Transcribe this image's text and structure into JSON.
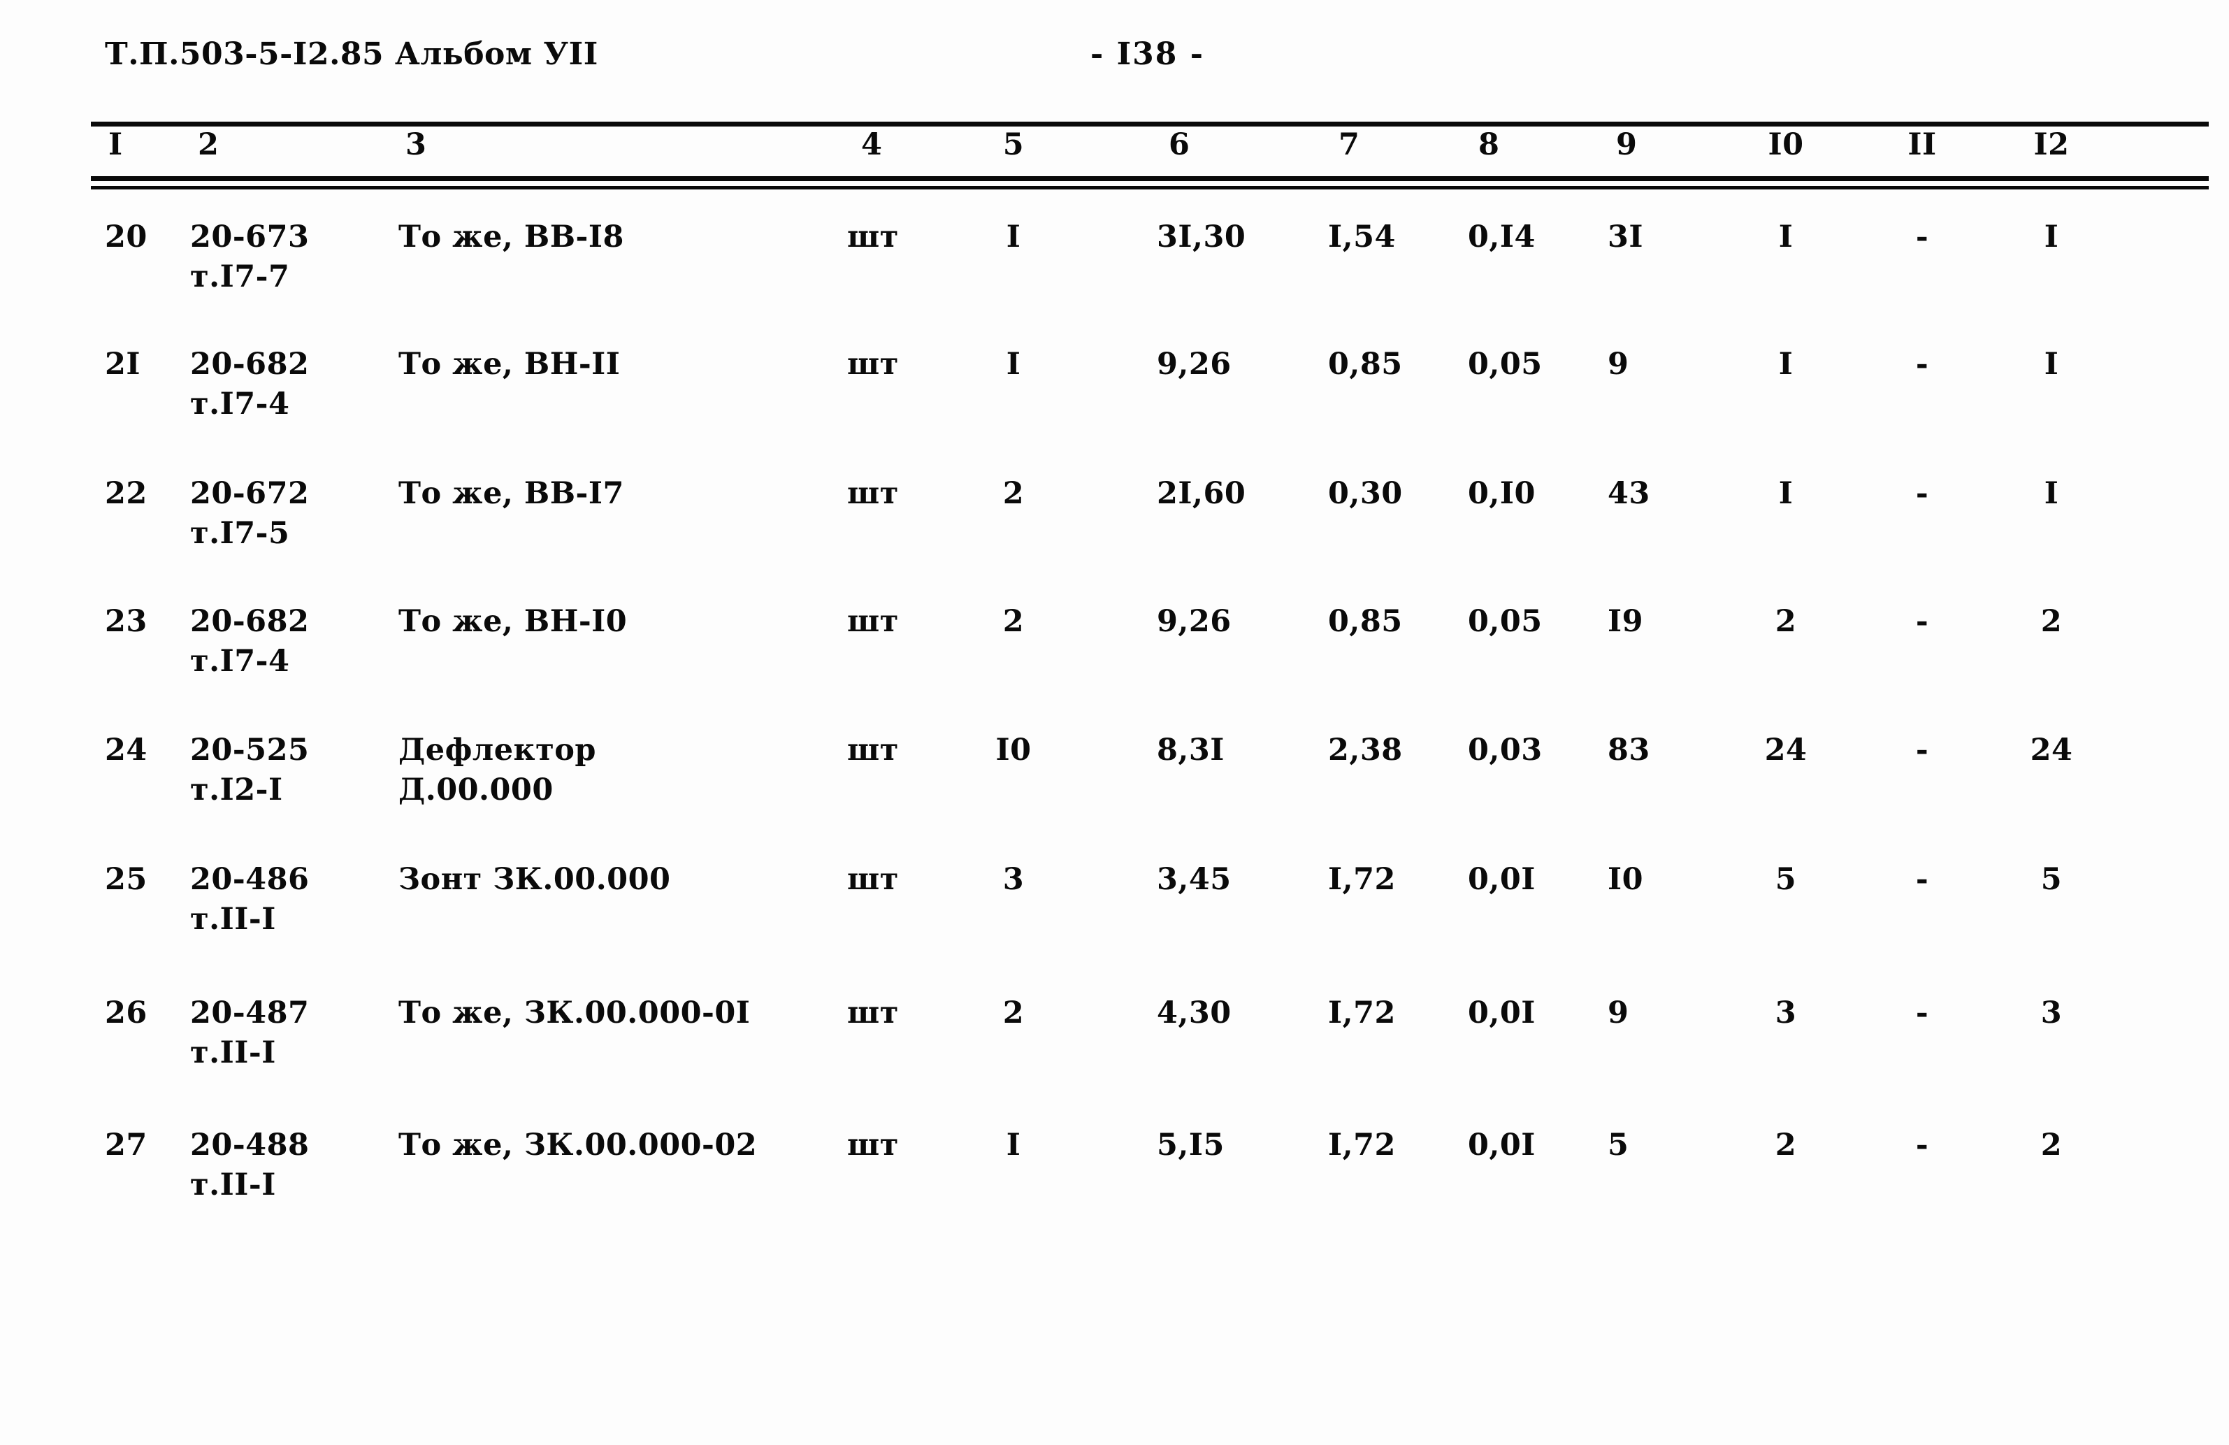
{
  "document": {
    "code": "Т.П.503-5-I2.85 Альбом УII",
    "page_label": "- I38 -"
  },
  "table": {
    "column_headers": [
      "I",
      "2",
      "3",
      "4",
      "5",
      "6",
      "7",
      "8",
      "9",
      "I0",
      "II",
      "I2"
    ],
    "rows": [
      {
        "num": "20",
        "code_line1": "20-673",
        "code_line2": "т.I7-7",
        "name_line1": "То же, ВВ-I8",
        "name_line2": "",
        "unit": "шт",
        "qty": "I",
        "val6": "3I,30",
        "val7": "I,54",
        "val8": "0,I4",
        "val9": "3I",
        "val10": "I",
        "val11": "-",
        "val12": "I"
      },
      {
        "num": "2I",
        "code_line1": "20-682",
        "code_line2": "т.I7-4",
        "name_line1": "То же, ВН-II",
        "name_line2": "",
        "unit": "шт",
        "qty": "I",
        "val6": "9,26",
        "val7": "0,85",
        "val8": "0,05",
        "val9": "9",
        "val10": "I",
        "val11": "-",
        "val12": "I"
      },
      {
        "num": "22",
        "code_line1": "20-672",
        "code_line2": "т.I7-5",
        "name_line1": "То же, ВВ-I7",
        "name_line2": "",
        "unit": "шт",
        "qty": "2",
        "val6": "2I,60",
        "val7": "0,30",
        "val8": "0,I0",
        "val9": "43",
        "val10": "I",
        "val11": "-",
        "val12": "I"
      },
      {
        "num": "23",
        "code_line1": "20-682",
        "code_line2": "т.I7-4",
        "name_line1": "То же, ВН-I0",
        "name_line2": "",
        "unit": "шт",
        "qty": "2",
        "val6": "9,26",
        "val7": "0,85",
        "val8": "0,05",
        "val9": "I9",
        "val10": "2",
        "val11": "-",
        "val12": "2"
      },
      {
        "num": "24",
        "code_line1": "20-525",
        "code_line2": "т.I2-I",
        "name_line1": "Дефлектор",
        "name_line2": "Д.00.000",
        "unit": "шт",
        "qty": "I0",
        "val6": "8,3I",
        "val7": "2,38",
        "val8": "0,03",
        "val9": "83",
        "val10": "24",
        "val11": "-",
        "val12": "24"
      },
      {
        "num": "25",
        "code_line1": "20-486",
        "code_line2": "т.II-I",
        "name_line1": "Зонт ЗК.00.000",
        "name_line2": "",
        "unit": "шт",
        "qty": "3",
        "val6": "3,45",
        "val7": "I,72",
        "val8": "0,0I",
        "val9": "I0",
        "val10": "5",
        "val11": "-",
        "val12": "5"
      },
      {
        "num": "26",
        "code_line1": "20-487",
        "code_line2": "т.II-I",
        "name_line1": "То же, ЗК.00.000-0I",
        "name_line2": "",
        "unit": "шт",
        "qty": "2",
        "val6": "4,30",
        "val7": "I,72",
        "val8": "0,0I",
        "val9": "9",
        "val10": "3",
        "val11": "-",
        "val12": "3"
      },
      {
        "num": "27",
        "code_line1": "20-488",
        "code_line2": "т.II-I",
        "name_line1": "То же, ЗК.00.000-02",
        "name_line2": "",
        "unit": "шт",
        "qty": "I",
        "val6": "5,I5",
        "val7": "I,72",
        "val8": "0,0I",
        "val9": "5",
        "val10": "2",
        "val11": "-",
        "val12": "2"
      }
    ]
  }
}
